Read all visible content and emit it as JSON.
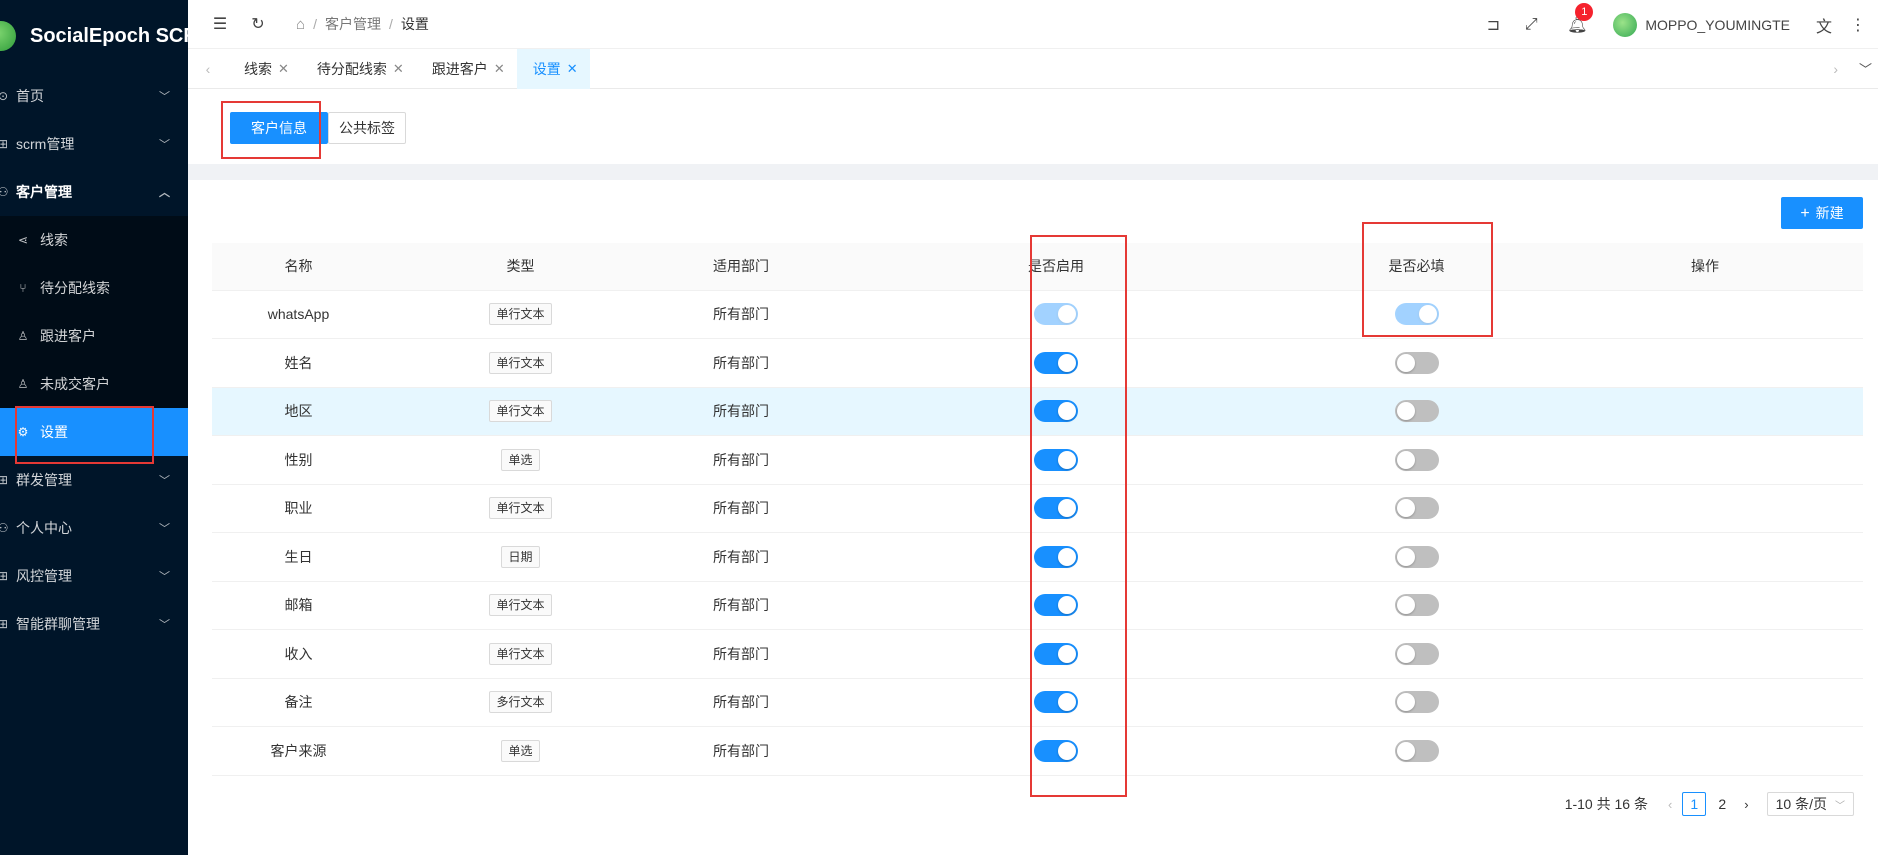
{
  "app": {
    "name": "SocialEpoch SCRM"
  },
  "sidebar": {
    "items": [
      {
        "label": "首页",
        "icon": "dashboard-icon",
        "expanded": false
      },
      {
        "label": "scrm管理",
        "icon": "appstore-icon",
        "expanded": false
      },
      {
        "label": "客户管理",
        "icon": "user-icon",
        "expanded": true
      },
      {
        "label": "群发管理",
        "icon": "appstore-icon",
        "expanded": false
      },
      {
        "label": "个人中心",
        "icon": "user-icon",
        "expanded": false
      },
      {
        "label": "风控管理",
        "icon": "appstore-icon",
        "expanded": false
      },
      {
        "label": "智能群聊管理",
        "icon": "appstore-icon",
        "expanded": false
      }
    ],
    "customer_submenu": [
      {
        "label": "线索",
        "icon": "share-icon"
      },
      {
        "label": "待分配线索",
        "icon": "branch-icon"
      },
      {
        "label": "跟进客户",
        "icon": "user-icon"
      },
      {
        "label": "未成交客户",
        "icon": "user-icon"
      },
      {
        "label": "设置",
        "icon": "gear-icon",
        "active": true
      }
    ]
  },
  "header": {
    "breadcrumb": [
      "客户管理",
      "设置"
    ],
    "notification_count": "1",
    "username": "MOPPO_YOUMINGTE"
  },
  "tabs": [
    {
      "label": "线索",
      "active": false
    },
    {
      "label": "待分配线索",
      "active": false
    },
    {
      "label": "跟进客户",
      "active": false
    },
    {
      "label": "设置",
      "active": true
    }
  ],
  "segment": {
    "customer_info": "客户信息",
    "public_tags": "公共标签"
  },
  "toolbar": {
    "new_button": "新建"
  },
  "table": {
    "columns": [
      "名称",
      "类型",
      "适用部门",
      "是否启用",
      "是否必填",
      "操作"
    ],
    "rows": [
      {
        "name": "whatsApp",
        "type": "单行文本",
        "dept": "所有部门",
        "enabled": true,
        "required": true,
        "locked": true
      },
      {
        "name": "姓名",
        "type": "单行文本",
        "dept": "所有部门",
        "enabled": true,
        "required": false
      },
      {
        "name": "地区",
        "type": "单行文本",
        "dept": "所有部门",
        "enabled": true,
        "required": false,
        "hover": true
      },
      {
        "name": "性别",
        "type": "单选",
        "dept": "所有部门",
        "enabled": true,
        "required": false
      },
      {
        "name": "职业",
        "type": "单行文本",
        "dept": "所有部门",
        "enabled": true,
        "required": false
      },
      {
        "name": "生日",
        "type": "日期",
        "dept": "所有部门",
        "enabled": true,
        "required": false
      },
      {
        "name": "邮箱",
        "type": "单行文本",
        "dept": "所有部门",
        "enabled": true,
        "required": false
      },
      {
        "name": "收入",
        "type": "单行文本",
        "dept": "所有部门",
        "enabled": true,
        "required": false
      },
      {
        "name": "备注",
        "type": "多行文本",
        "dept": "所有部门",
        "enabled": true,
        "required": false
      },
      {
        "name": "客户来源",
        "type": "单选",
        "dept": "所有部门",
        "enabled": true,
        "required": false
      }
    ]
  },
  "pagination": {
    "summary": "1-10 共 16 条",
    "pages": [
      "1",
      "2"
    ],
    "current": "1",
    "page_size": "10 条/页"
  },
  "colors": {
    "primary": "#1890ff",
    "sidebar_bg": "#001529",
    "annotation": "#e53935"
  }
}
